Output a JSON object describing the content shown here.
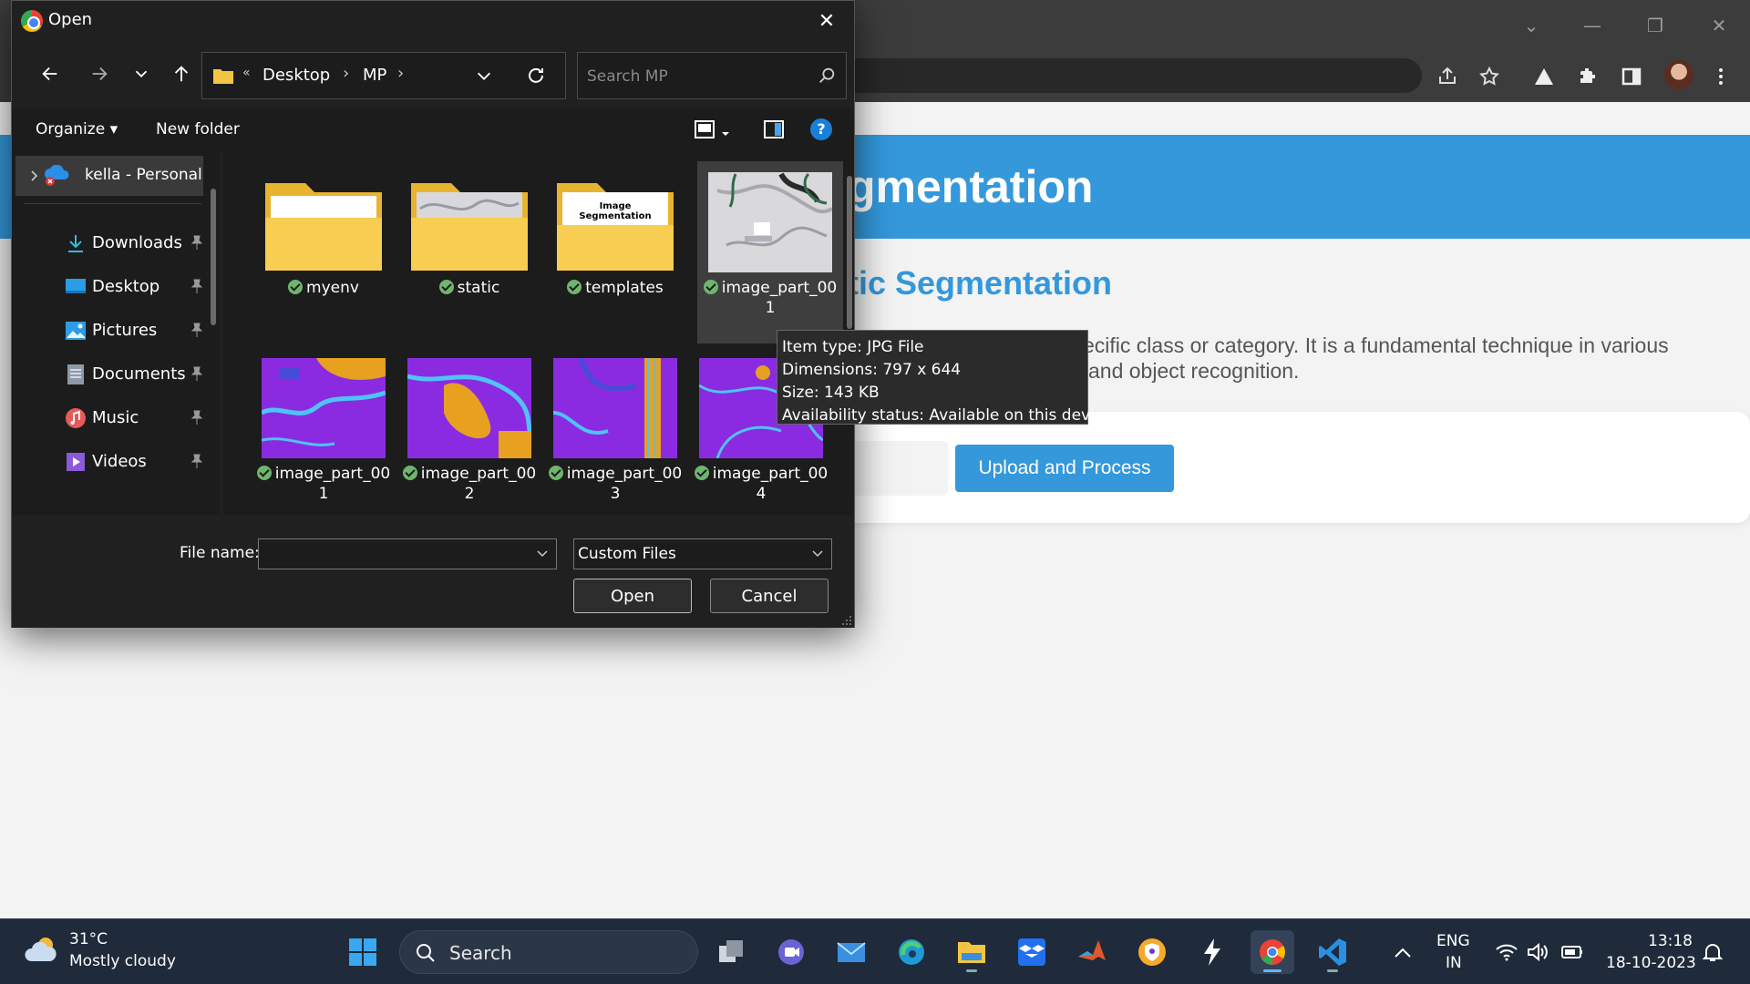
{
  "dialog": {
    "title": "Open",
    "nav": {
      "breadcrumb_overflow": "«",
      "breadcrumbs": [
        "Desktop",
        "MP"
      ],
      "crumb_separator": "›",
      "search_placeholder": "Search MP"
    },
    "commandbar": {
      "organize_label": "Organize ▾",
      "new_folder_label": "New folder",
      "help_label": "?"
    },
    "nav_pane": {
      "onedrive_label": "kella - Personal",
      "quick_access": [
        {
          "label": "Downloads",
          "icon": "download-icon"
        },
        {
          "label": "Desktop",
          "icon": "desktop-icon"
        },
        {
          "label": "Pictures",
          "icon": "pictures-icon"
        },
        {
          "label": "Documents",
          "icon": "documents-icon"
        },
        {
          "label": "Music",
          "icon": "music-icon"
        },
        {
          "label": "Videos",
          "icon": "videos-icon"
        }
      ]
    },
    "files": [
      {
        "name": "myenv",
        "kind": "folder"
      },
      {
        "name": "static",
        "kind": "folder"
      },
      {
        "name": "templates",
        "kind": "folder",
        "preview_text": "Image Segmentation"
      },
      {
        "name_line1": "image_part_00",
        "name_line2": "1",
        "kind": "image",
        "selected": true
      },
      {
        "name_line1": "image_part_00",
        "name_line2": "1",
        "kind": "image"
      },
      {
        "name_line1": "image_part_00",
        "name_line2": "2",
        "kind": "image"
      },
      {
        "name_line1": "image_part_00",
        "name_line2": "3",
        "kind": "image"
      },
      {
        "name_line1": "image_part_00",
        "name_line2": "4",
        "kind": "image"
      }
    ],
    "tooltip": {
      "type": "Item type: JPG File",
      "dimensions": "Dimensions: 797 x 644",
      "size": "Size: 143 KB",
      "availability": "Availability status: Available on this device"
    },
    "footer": {
      "filename_label": "File name:",
      "filename_value": "",
      "filetype_value": "Custom Files",
      "open_label": "Open",
      "cancel_label": "Cancel"
    }
  },
  "page": {
    "title": "gmentation",
    "subtitle": "tic Segmentation",
    "desc_line1": "ecific class or category. It is a fundamental technique in various",
    "desc_line2": "and object recognition.",
    "upload_button": "Upload and Process"
  },
  "taskbar": {
    "weather_temp": "31°C",
    "weather_desc": "Mostly cloudy",
    "search_label": "Search",
    "lang_line1": "ENG",
    "lang_line2": "IN",
    "time": "13:18",
    "date": "18-10-2023"
  },
  "colors": {
    "accent": "#3498db",
    "dialog_bg": "#202020",
    "segmentation_purple": "#8a2be2",
    "segmentation_orange": "#e8a020",
    "segmentation_cyan": "#4fc3f7"
  }
}
